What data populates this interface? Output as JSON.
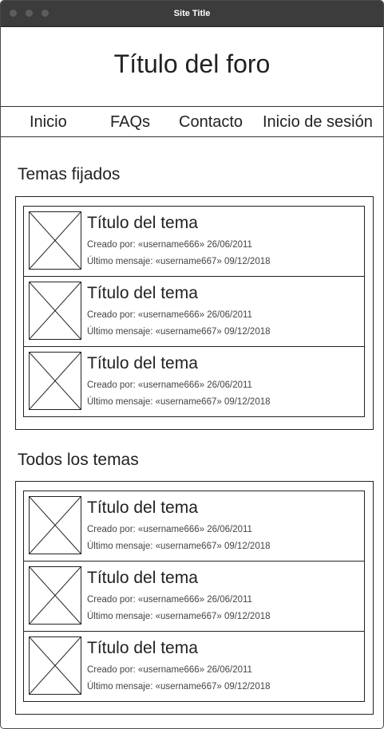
{
  "window": {
    "title": "Site Title"
  },
  "header": {
    "title": "Título del foro"
  },
  "nav": {
    "items": [
      {
        "label": "Inicio"
      },
      {
        "label": "FAQs"
      },
      {
        "label": "Contacto"
      },
      {
        "label": "Inicio de sesión"
      }
    ]
  },
  "pinned": {
    "heading": "Temas fijados",
    "topics": [
      {
        "title": "Título del tema",
        "created": "Creado por: «username666» 26/06/2011",
        "last": "Último mensaje: «username667» 09/12/2018"
      },
      {
        "title": "Título del tema",
        "created": "Creado por: «username666» 26/06/2011",
        "last": "Último mensaje: «username667» 09/12/2018"
      },
      {
        "title": "Título del tema",
        "created": "Creado por: «username666» 26/06/2011",
        "last": "Último mensaje: «username667» 09/12/2018"
      }
    ]
  },
  "all": {
    "heading": "Todos los temas",
    "topics": [
      {
        "title": "Título del tema",
        "created": "Creado por: «username666» 26/06/2011",
        "last": "Último mensaje: «username667» 09/12/2018"
      },
      {
        "title": "Título del tema",
        "created": "Creado por: «username666» 26/06/2011",
        "last": "Último mensaje: «username667» 09/12/2018"
      },
      {
        "title": "Título del tema",
        "created": "Creado por: «username666» 26/06/2011",
        "last": "Último mensaje: «username667» 09/12/2018"
      }
    ]
  }
}
